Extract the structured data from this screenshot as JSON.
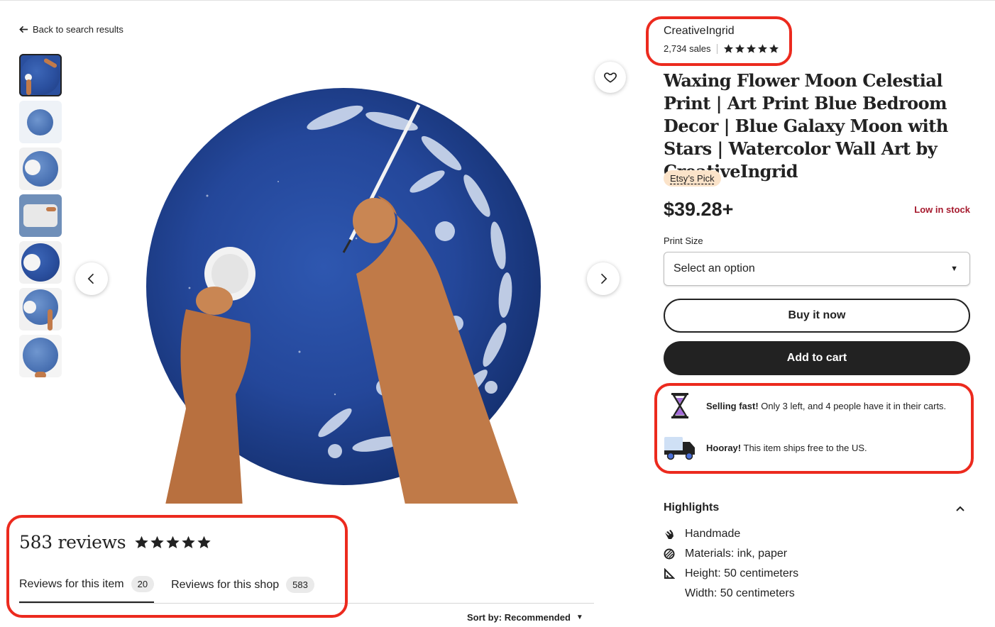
{
  "nav": {
    "back_label": "Back to search results"
  },
  "gallery": {
    "thumb_count": 7,
    "active_index": 0
  },
  "shop": {
    "name": "CreativeIngrid",
    "sales": "2,734 sales",
    "rating_stars": 5
  },
  "listing": {
    "title": "Waxing Flower Moon Celestial Print | Art Print Blue Bedroom Decor | Blue Galaxy Moon with Stars | Watercolor Wall Art by CreativeIngrid",
    "badge": "Etsy’s Pick",
    "price": "$39.28+",
    "stock_status": "Low in stock",
    "option_label": "Print Size",
    "option_placeholder": "Select an option",
    "buy_now": "Buy it now",
    "add_to_cart": "Add to cart"
  },
  "notices": [
    {
      "bold": "Selling fast!",
      "text": " Only 3 left, and 4 people have it in their carts.",
      "icon": "hourglass-icon"
    },
    {
      "bold": "Hooray!",
      "text": " This item ships free to the US.",
      "icon": "truck-icon"
    }
  ],
  "highlights": {
    "title": "Highlights",
    "items": [
      {
        "icon": "handmade-icon",
        "text": "Handmade"
      },
      {
        "icon": "materials-icon",
        "text": "Materials: ink, paper"
      },
      {
        "icon": "ruler-icon",
        "text": "Height: 50 centimeters"
      },
      {
        "icon": "",
        "text": "Width: 50 centimeters"
      }
    ]
  },
  "reviews": {
    "count_label": "583 reviews",
    "stars": 5,
    "tabs": [
      {
        "label": "Reviews for this item",
        "count": "20"
      },
      {
        "label": "Reviews for this shop",
        "count": "583"
      }
    ],
    "sort_label": "Sort by: Recommended"
  },
  "colors": {
    "annotation": "#ec2a1e",
    "stock_red": "#a61a2e",
    "badge_bg": "#fbe3c9",
    "dark_button": "#222222"
  }
}
